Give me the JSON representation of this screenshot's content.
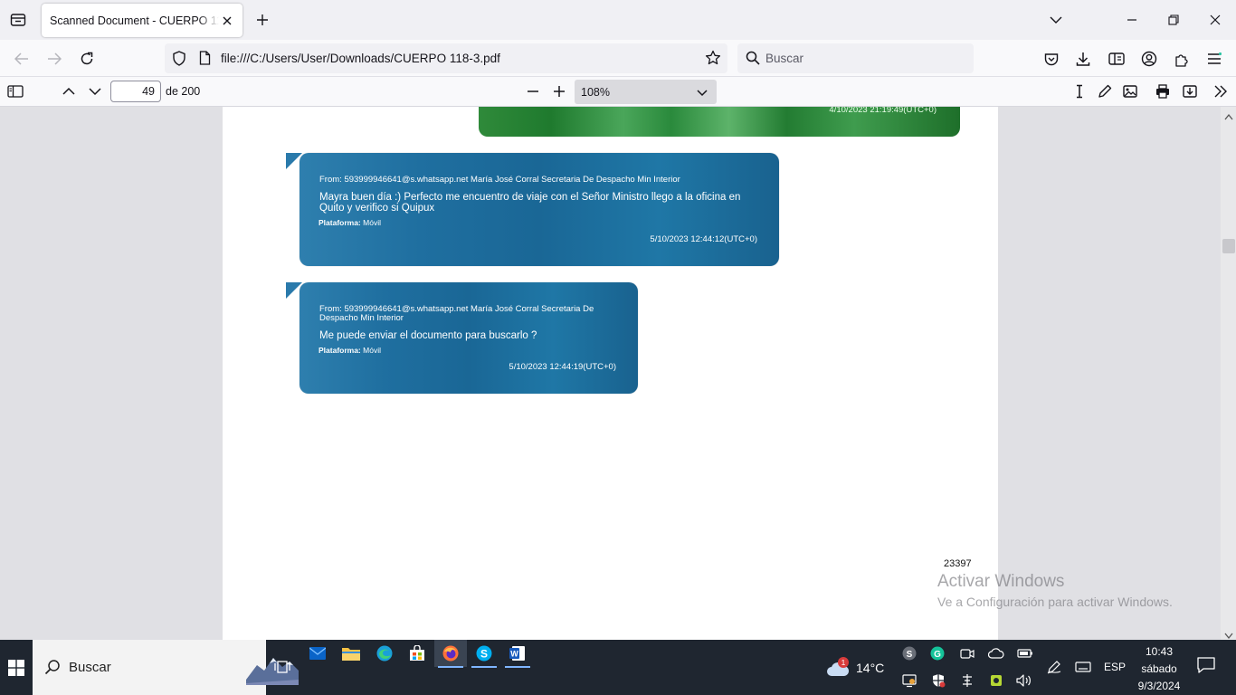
{
  "browser": {
    "tab": {
      "title": "Scanned Document - CUERPO 118-3.pdf"
    },
    "url": "file:///C:/Users/User/Downloads/CUERPO 118-3.pdf",
    "search_placeholder": "Buscar"
  },
  "pdf_toolbar": {
    "page_current": "49",
    "page_total_label": "de 200",
    "zoom": "108%"
  },
  "document": {
    "top_bubble_time": "4/10/2023 21:19:49(UTC+0)",
    "messages": [
      {
        "from": "From: 593999946641@s.whatsapp.net María José  Corral Secretaria De Despacho Min Interior",
        "text": "Mayra buen día :) Perfecto me encuentro de viaje con el Señor Ministro llego a la oficina en Quito y verifico si Quipux",
        "platform_label": "Plataforma:",
        "platform_value": "Móvil",
        "time": "5/10/2023 12:44:12(UTC+0)"
      },
      {
        "from": "From: 593999946641@s.whatsapp.net María José  Corral Secretaria De Despacho Min Interior",
        "text": "Me puede enviar el documento para buscarlo ?",
        "platform_label": "Plataforma:",
        "platform_value": "Móvil",
        "time": "5/10/2023 12:44:19(UTC+0)"
      }
    ],
    "page_number": "23397"
  },
  "watermark": {
    "line1": "Activar Windows",
    "line2": "Ve a Configuración para activar Windows."
  },
  "taskbar": {
    "search_placeholder": "Buscar",
    "weather_temp": "14°C",
    "weather_badge": "1",
    "language": "ESP",
    "time": "10:43",
    "day": "sábado",
    "date": "9/3/2024"
  },
  "colors": {
    "bubble_blue": "#1f6fa0",
    "bubble_green": "#2a8a3c",
    "taskbar": "#1f2630"
  }
}
